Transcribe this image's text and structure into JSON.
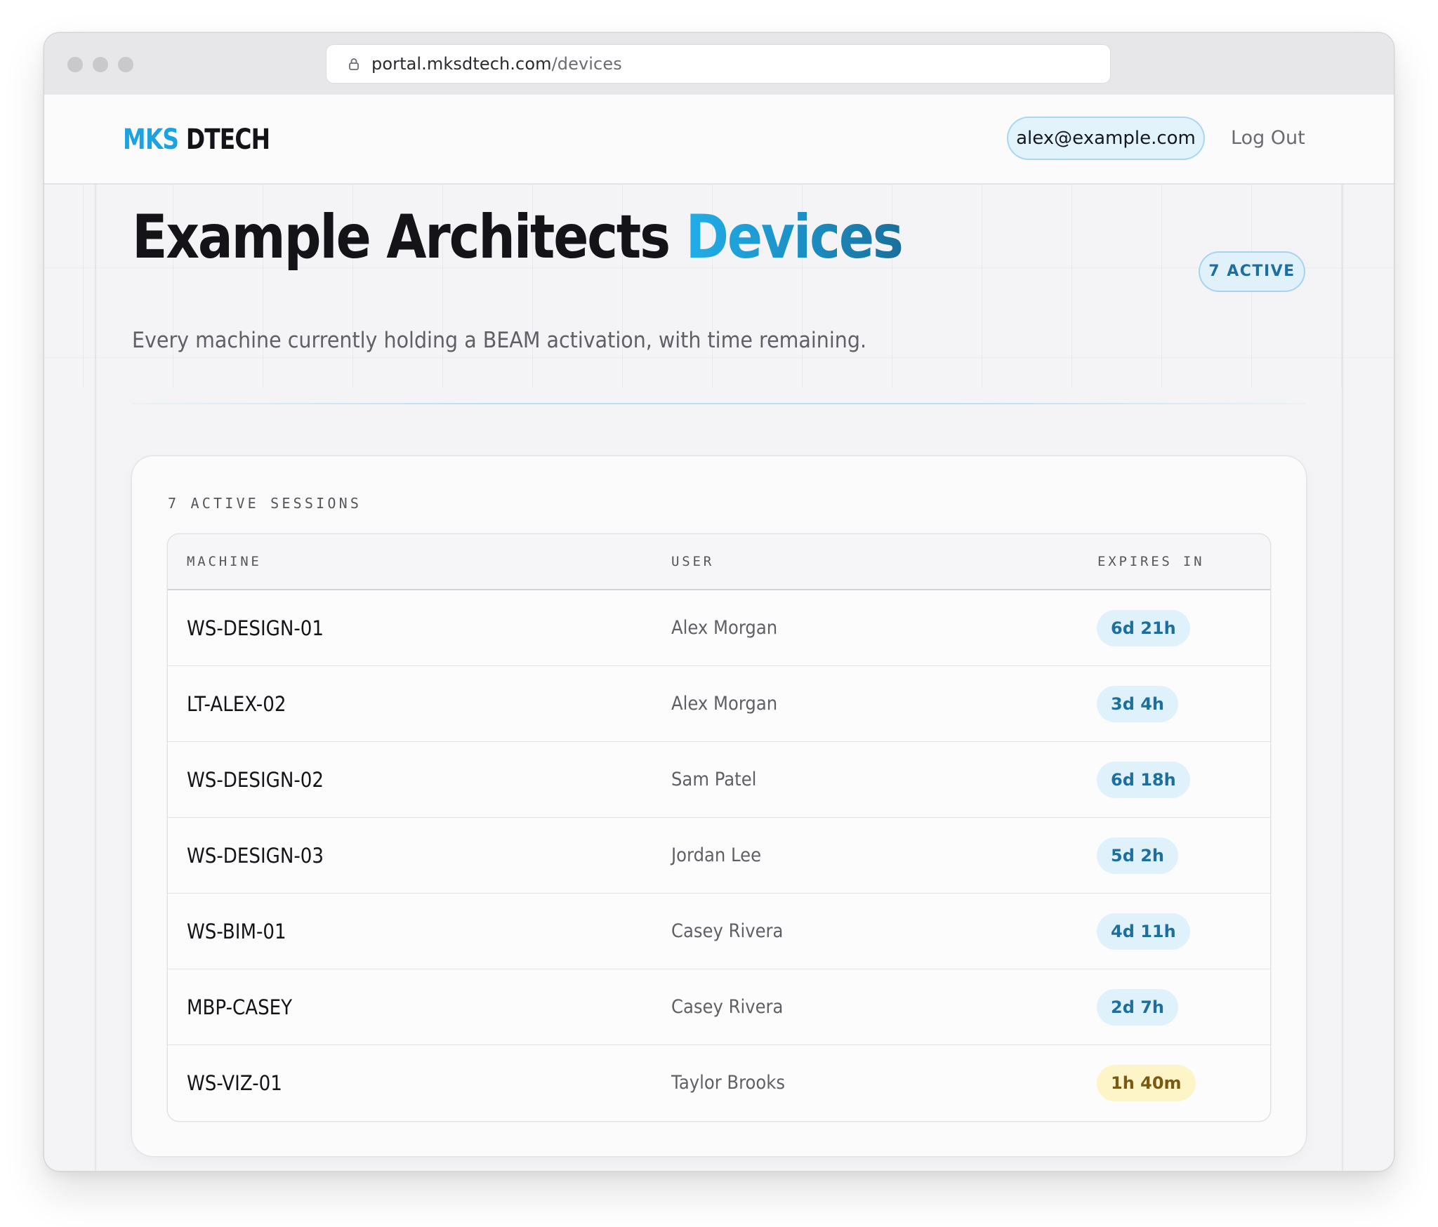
{
  "browser": {
    "url_host": "portal.mksdtech.com",
    "url_path": "/devices"
  },
  "header": {
    "logo_part1": "MKS",
    "logo_part2": "DTECH",
    "user_email": "alex@example.com",
    "logout_label": "Log Out"
  },
  "page": {
    "title_prefix": "Example Architects",
    "title_accent": "Devices",
    "subtitle": "Every machine currently holding a BEAM activation, with time remaining.",
    "active_badge": "7 ACTIVE"
  },
  "sessions": {
    "heading": "7 ACTIVE SESSIONS",
    "columns": [
      "MACHINE",
      "USER",
      "EXPIRES IN"
    ],
    "rows": [
      {
        "machine": "WS-DESIGN-01",
        "user": "Alex Morgan",
        "expires": "6d 21h",
        "status": "ok"
      },
      {
        "machine": "LT-ALEX-02",
        "user": "Alex Morgan",
        "expires": "3d 4h",
        "status": "ok"
      },
      {
        "machine": "WS-DESIGN-02",
        "user": "Sam Patel",
        "expires": "6d 18h",
        "status": "ok"
      },
      {
        "machine": "WS-DESIGN-03",
        "user": "Jordan Lee",
        "expires": "5d 2h",
        "status": "ok"
      },
      {
        "machine": "WS-BIM-01",
        "user": "Casey Rivera",
        "expires": "4d 11h",
        "status": "ok"
      },
      {
        "machine": "MBP-CASEY",
        "user": "Casey Rivera",
        "expires": "2d 7h",
        "status": "ok"
      },
      {
        "machine": "WS-VIZ-01",
        "user": "Taylor Brooks",
        "expires": "1h 40m",
        "status": "warn"
      }
    ]
  },
  "colors": {
    "brand": "#1aa3e0",
    "badge_ok_bg": "#dff1fb",
    "badge_warn_bg": "#fdf5c7"
  }
}
